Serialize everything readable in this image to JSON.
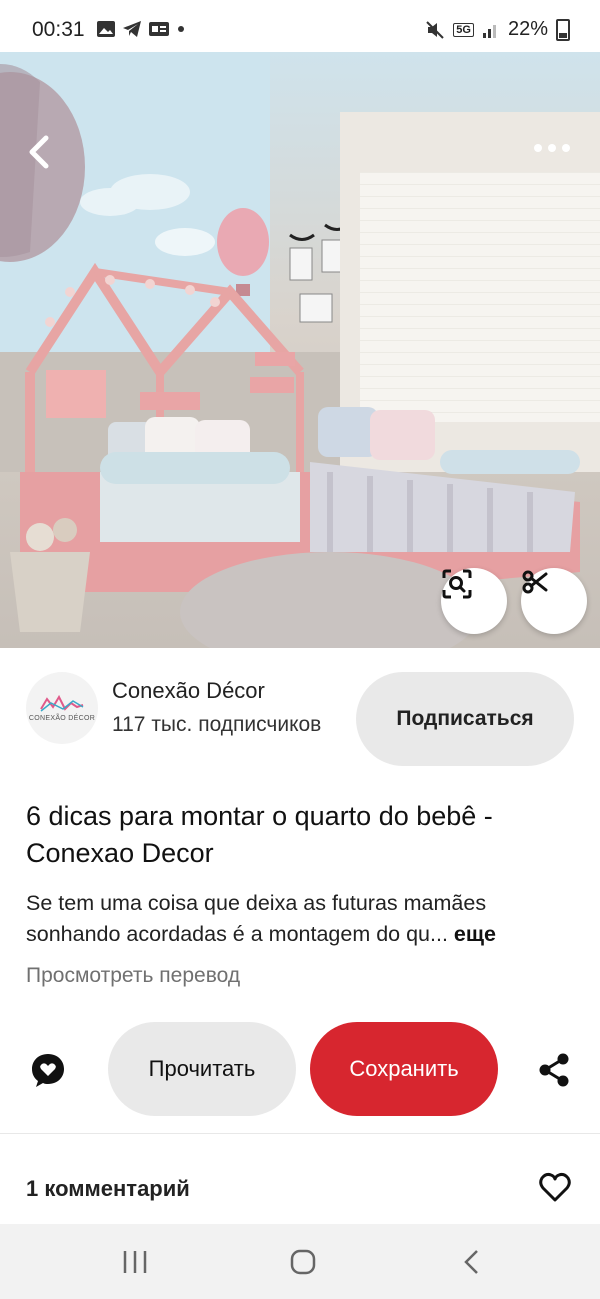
{
  "status_bar": {
    "time": "00:31",
    "network": "5G",
    "battery": "22%"
  },
  "pin": {
    "image_alt": "Детская комната с кроватью-домиком",
    "icons": {
      "back": "chevron-left-icon",
      "more": "more-dots-icon",
      "visual_search": "visual-search-icon",
      "cutout": "scissors-icon"
    }
  },
  "creator": {
    "name": "Conexão Décor",
    "subscribers": "117 тыс. подписчиков",
    "logo_text": "CONEXÃO DÉCOR",
    "subscribe_label": "Подписаться"
  },
  "content": {
    "title": "6 dicas para montar o quarto do bebê - Conexao Decor",
    "description": "Se tem uma coisa que deixa as futuras mamães sonhando acordadas é a montagem do qu...",
    "more_label": "еще",
    "translate_label": "Просмотреть перевод"
  },
  "actions": {
    "read_label": "Прочитать",
    "save_label": "Сохранить",
    "save_color": "#d7262f"
  },
  "comments": {
    "count_label": "1 комментарий"
  }
}
